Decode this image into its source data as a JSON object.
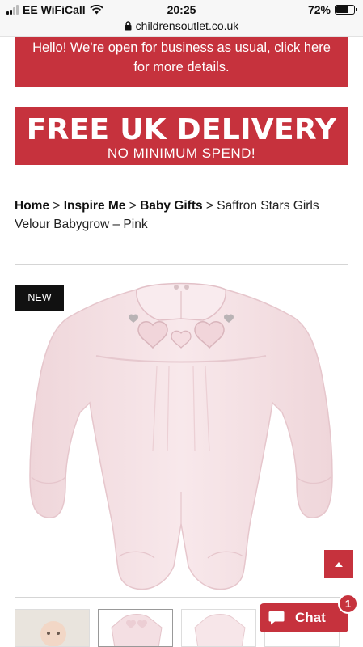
{
  "status_bar": {
    "carrier": "EE WiFiCall",
    "time": "20:25",
    "battery": "72%",
    "battery_level": 0.72
  },
  "browser": {
    "url": "childrensoutlet.co.uk"
  },
  "notice": {
    "text_before": "Hello! We're open for business as usual, ",
    "link_text": "click here",
    "text_after": "for more details."
  },
  "delivery_banner": {
    "headline": "FREE UK DELIVERY",
    "subline": "NO MINIMUM SPEND!"
  },
  "breadcrumb": {
    "items": [
      "Home",
      "Inspire Me",
      "Baby Gifts"
    ],
    "separator": " > ",
    "current": "Saffron Stars Girls Velour Babygrow – Pink"
  },
  "product": {
    "badge": "NEW",
    "color_name": "Pink",
    "garment_color": "#f6e4e7"
  },
  "chat": {
    "label": "Chat",
    "unread_count": "1"
  },
  "colors": {
    "accent": "#c6323d"
  }
}
